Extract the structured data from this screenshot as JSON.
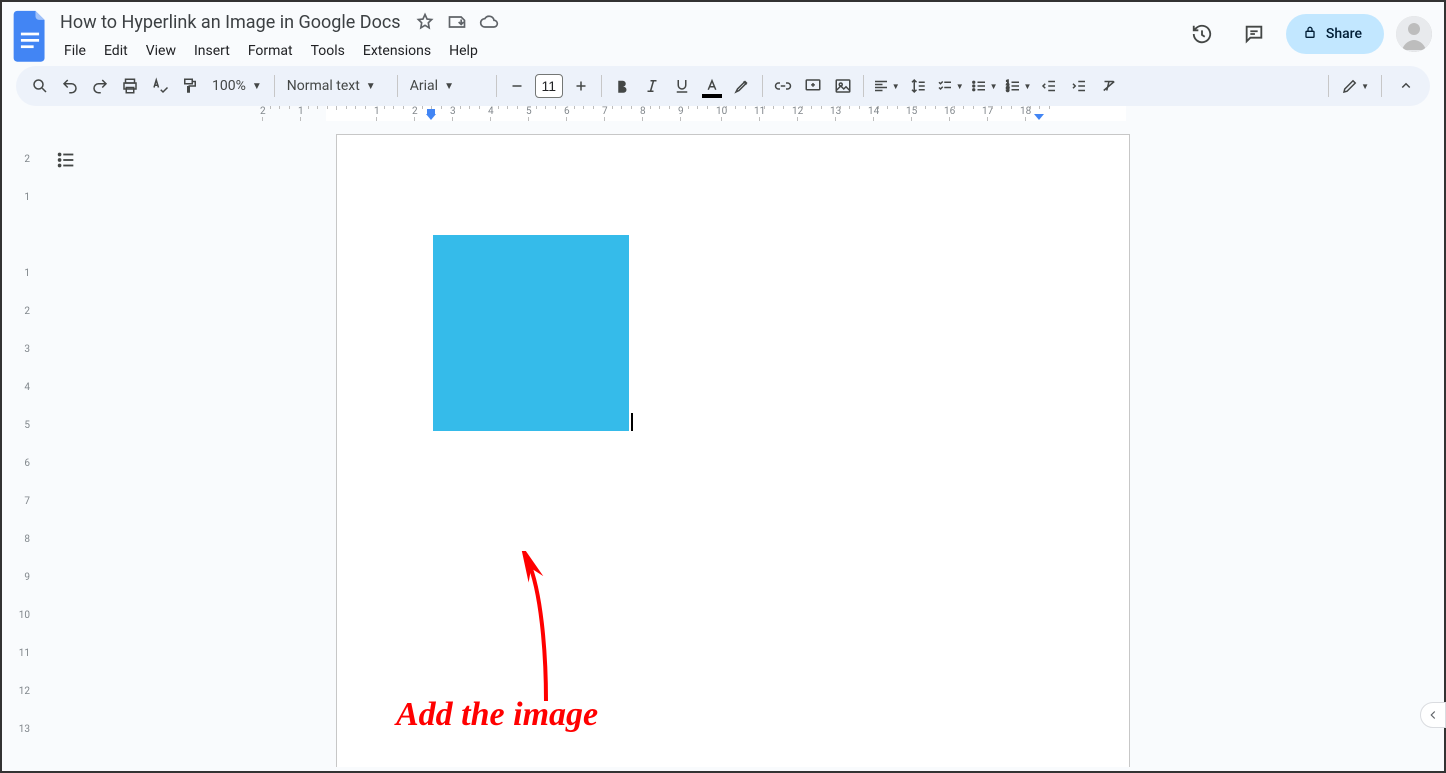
{
  "header": {
    "doc_title": "How to Hyperlink an Image in Google Docs",
    "menus": [
      "File",
      "Edit",
      "View",
      "Insert",
      "Format",
      "Tools",
      "Extensions",
      "Help"
    ],
    "share_label": "Share"
  },
  "toolbar": {
    "zoom": "100%",
    "paragraph_style": "Normal text",
    "font": "Arial",
    "font_size": "11"
  },
  "ruler": {
    "horizontal": [
      "2",
      "1",
      "",
      "1",
      "2",
      "3",
      "4",
      "5",
      "6",
      "7",
      "8",
      "9",
      "10",
      "11",
      "12",
      "13",
      "14",
      "15",
      "16",
      "17",
      "18"
    ],
    "vertical": [
      "2",
      "1",
      "",
      "1",
      "2",
      "3",
      "4",
      "5",
      "6",
      "7",
      "8",
      "9",
      "10",
      "11",
      "12",
      "13"
    ]
  },
  "document": {
    "image_color": "#35bbea"
  },
  "annotation": {
    "text": "Add the image"
  }
}
